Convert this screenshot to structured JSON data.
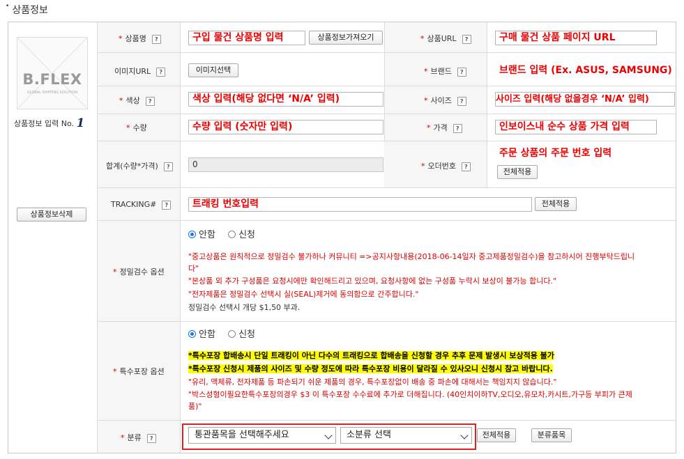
{
  "section_title": "상품정보",
  "left": {
    "logo_brand": "B.FLEX",
    "logo_tagline": "GLOBAL SHIPPING SOLUTION",
    "product_input_label": "상품정보 입력 No.",
    "product_input_number": "1",
    "delete_button": "상품정보삭제"
  },
  "rows": {
    "product_name": {
      "label": "상품명",
      "value": "구입 물건 상품명 입력",
      "button": "상품정보가져오기"
    },
    "product_url": {
      "label": "상품URL",
      "value": "구매 물건 상품 페이지 URL"
    },
    "image_url": {
      "label": "이미지URL",
      "button": "이미지선택"
    },
    "brand": {
      "label": "브랜드",
      "value": "브랜드 입력 (Ex. ASUS, SAMSUNG)"
    },
    "color": {
      "label": "색상",
      "value": "색상 입력(해당 없다면 ‘N/A’ 입력)"
    },
    "size": {
      "label": "사이즈",
      "value": "사이즈 입력(해당 없을경우 ‘N/A’ 입력)"
    },
    "quantity": {
      "label": "수량",
      "value": "수량 입력 (숫자만 입력)"
    },
    "price": {
      "label": "가격",
      "value": "인보이스내 순수 상품 가격 입력"
    },
    "total": {
      "label": "합계(수량*가격)",
      "value": "0"
    },
    "order_no": {
      "label": "오더번호",
      "value": "주문 상품의 주문 번호 입력",
      "button": "전체적용"
    },
    "tracking": {
      "label": "TRACKING#",
      "value": "트래킹 번호입력",
      "button": "전체적용"
    },
    "inspection": {
      "label": "정밀검수 옵션",
      "option_off": "안함",
      "option_on": "신청",
      "notes": [
        "\"중고상품은 원칙적으로 정밀검수 불가하나 커뮤니티 =>공지사항내용(2018-06-14일자 중고제품정밀검수)을 참고하시어 진행부탁드립니",
        "다\"",
        "\"본상품 외 추가 구성품은 요청시에만 확인해드리고 있으며, 요청사항에 없는 구성품 누락시 보상이 불가능 합니다.\"",
        "\"전자제품은 정밀검수 선택시 실(SEAL)제거에 동의함으로 간주합니다.\""
      ],
      "fee_note": "정밀검수 선택시 개당 $1,50 부과."
    },
    "special_packing": {
      "label": "특수포장 옵션",
      "option_off": "안함",
      "option_on": "신청",
      "highlights": [
        "*특수포장 합배송시 단일 트래킹이 아닌 다수의 트래킹으로 합배송을 신청할 경우 추후 문제 발생시 보상적용 불가",
        "*특수포장 신청시 제품의 사이즈 및 수량 정도에 따라 특수포장 비용이 달라질 수 있사오니 신청시 참고 바랍니다."
      ],
      "notes": [
        "\"유리, 액체류, 전자제품 등 파손되기 쉬운 제품의 경우, 특수포장없이 배송 중 파손에 대해서는 책임지지 않습니다.\"",
        "\"박스성형이필요한특수포장의경우 $3 이 특수포장 수수료에 추가로 더해집니다. (40인치이하TV,오디오,유모차,카시트,가구등 부피가 큰제",
        "품)\""
      ]
    },
    "category": {
      "label": "분류",
      "select_main": "통관품목을 선택해주세요",
      "select_sub": "소분류 선택",
      "apply_button": "전체적용",
      "items_button": "분류품목"
    }
  },
  "colors": {
    "required": "#cc0000",
    "note_red": "#dd0000",
    "highlight": "#ffff00",
    "radio_on": "#1a73e8",
    "callout_box": "#e02020"
  }
}
